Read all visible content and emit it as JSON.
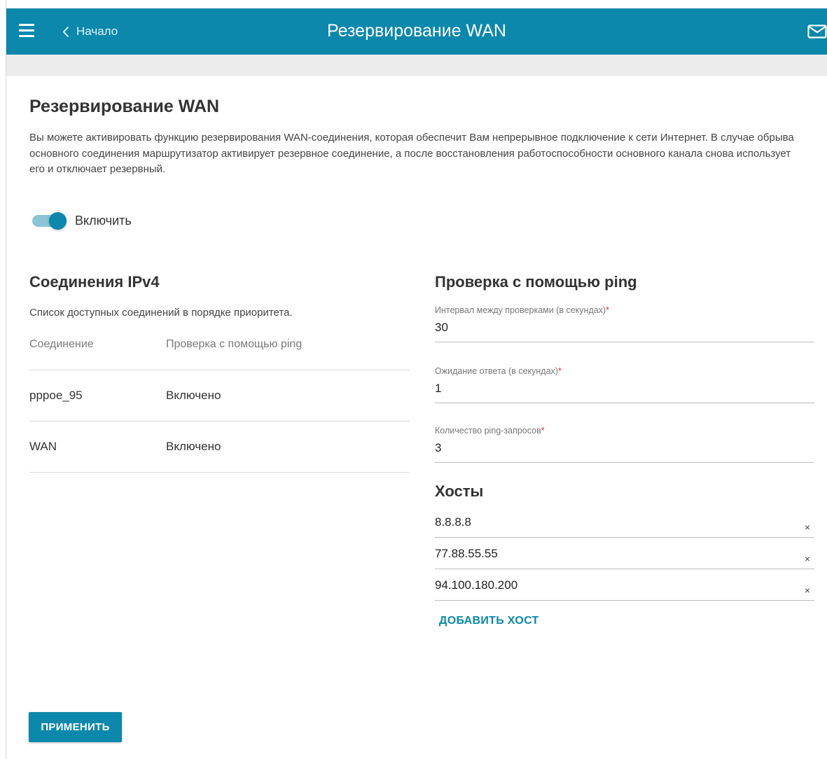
{
  "header": {
    "back_label": "Начало",
    "title": "Резервирование WAN",
    "menu_icon": "hamburger-icon",
    "back_icon": "chevron-left-icon",
    "mail_icon": "mail-icon"
  },
  "page": {
    "title": "Резервирование WAN",
    "description": "Вы можете активировать функцию резервирования WAN-соединения, которая обеспечит Вам непрерывное подключение к сети Интернет. В случае обрыва основного соединения маршрутизатор активирует резервное соединение, а после восстановления работоспособности основного канала снова использует его и отключает резервный."
  },
  "enable_switch": {
    "label": "Включить",
    "checked": true
  },
  "connections": {
    "title": "Соединения IPv4",
    "subtitle": "Список доступных соединений в порядке приоритета.",
    "columns": [
      "Соединение",
      "Проверка с помощью ping"
    ],
    "rows": [
      {
        "name": "pppoe_95",
        "ping": "Включено"
      },
      {
        "name": "WAN",
        "ping": "Включено"
      }
    ]
  },
  "ping_check": {
    "title": "Проверка с помощью ping",
    "interval": {
      "label": "Интервал между проверками (в секундах)",
      "required_mark": "*",
      "value": "30"
    },
    "timeout": {
      "label": "Ожидание ответа (в секундах)",
      "required_mark": "*",
      "value": "1"
    },
    "count": {
      "label": "Количество ping-запросов",
      "required_mark": "*",
      "value": "3"
    },
    "hosts_title": "Хосты",
    "hosts": [
      "8.8.8.8",
      "77.88.55.55",
      "94.100.180.200"
    ],
    "clear_symbol": "×",
    "add_host_label": "ДОБАВИТЬ ХОСТ"
  },
  "apply_label": "ПРИМЕНИТЬ",
  "colors": {
    "accent": "#0b88ac",
    "required": "#d32f2f"
  }
}
